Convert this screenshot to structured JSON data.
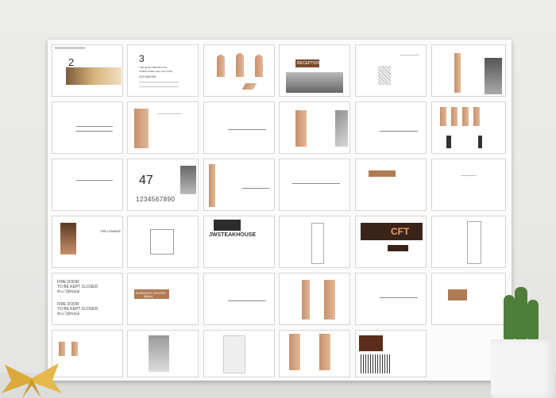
{
  "pages": {
    "p2": {
      "number": "2"
    },
    "p3": {
      "number": "3",
      "heading_lines": [
        "THE QUICK BROWN FOX",
        "JUMPS OVER THE LAZY DOG"
      ],
      "code": "333 456789"
    },
    "reception": {
      "label": "RECEPTION"
    },
    "digits": {
      "big": "47",
      "row": "1234567890"
    },
    "lounge": {
      "label": "THE LOUNGE"
    },
    "steakhouse": {
      "label": "JWSTEAKHOUSE"
    },
    "cft": {
      "label": "CFT"
    },
    "fire_door": {
      "lines_a": [
        "FIRE DOOR",
        "TO BE KEPT CLOSED",
        "防火门保持关闭"
      ],
      "lines_b": [
        "FIRE DOOR",
        "TO BE KEPT CLOSED",
        "防火门保持关闭"
      ]
    },
    "business_center": {
      "label": "BUSINESS CENTER",
      "sub": "商务中心"
    }
  },
  "colors": {
    "wood": "#c9906a",
    "dark": "#4b3a2d",
    "plant": "#4f7d3a",
    "gold": "#d9a93a"
  },
  "decor": {
    "left": "gold-bow",
    "right": "potted-cactus"
  }
}
